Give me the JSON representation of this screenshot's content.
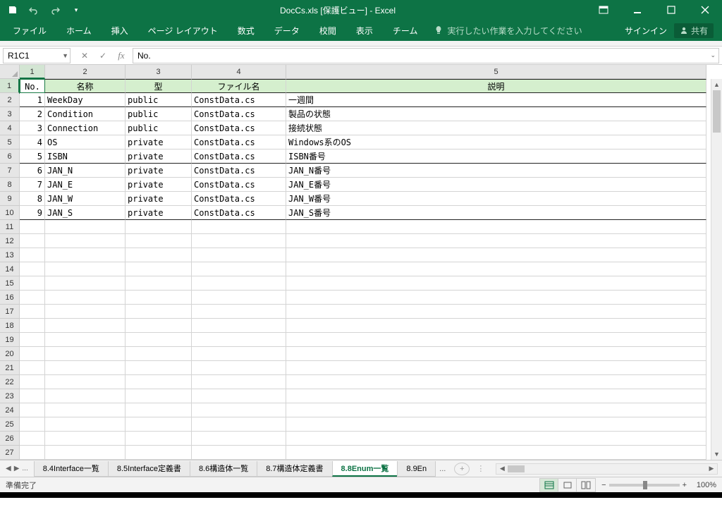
{
  "app": {
    "title": "DocCs.xls  [保護ビュー] - Excel",
    "qat": {
      "save": "save",
      "undo": "undo",
      "redo": "redo"
    }
  },
  "window": {
    "restore": "restore",
    "minimize": "minimize",
    "maximize": "maximize",
    "close": "close"
  },
  "ribbon": {
    "tabs": [
      "ファイル",
      "ホーム",
      "挿入",
      "ページ レイアウト",
      "数式",
      "データ",
      "校閲",
      "表示",
      "チーム"
    ],
    "tellme": "実行したい作業を入力してください",
    "signin": "サインイン",
    "share": "共有"
  },
  "formula": {
    "name_box": "R1C1",
    "value": "No."
  },
  "columns": [
    "1",
    "2",
    "3",
    "4",
    "5"
  ],
  "headers": [
    "No.",
    "名称",
    "型",
    "ファイル名",
    "説明"
  ],
  "rows": [
    {
      "no": "1",
      "name": "WeekDay",
      "type": "public",
      "file": "ConstData.cs",
      "desc": "一週間"
    },
    {
      "no": "2",
      "name": "Condition",
      "type": "public",
      "file": "ConstData.cs",
      "desc": "製品の状態"
    },
    {
      "no": "3",
      "name": "Connection",
      "type": "public",
      "file": "ConstData.cs",
      "desc": "接続状態"
    },
    {
      "no": "4",
      "name": "OS",
      "type": "private",
      "file": "ConstData.cs",
      "desc": "Windows系のOS"
    },
    {
      "no": "5",
      "name": "ISBN",
      "type": "private",
      "file": "ConstData.cs",
      "desc": "ISBN番号"
    },
    {
      "no": "6",
      "name": "JAN_N",
      "type": "private",
      "file": "ConstData.cs",
      "desc": "JAN_N番号"
    },
    {
      "no": "7",
      "name": "JAN_E",
      "type": "private",
      "file": "ConstData.cs",
      "desc": "JAN_E番号"
    },
    {
      "no": "8",
      "name": "JAN_W",
      "type": "private",
      "file": "ConstData.cs",
      "desc": "JAN_W番号"
    },
    {
      "no": "9",
      "name": "JAN_S",
      "type": "private",
      "file": "ConstData.cs",
      "desc": "JAN_S番号"
    }
  ],
  "empty_rows": 17,
  "sheet_tabs": {
    "hidden_left": "...",
    "tabs": [
      "8.4Interface一覧",
      "8.5Interface定義書",
      "8.6構造体一覧",
      "8.7構造体定義書",
      "8.8Enum一覧",
      "8.9En"
    ],
    "active": "8.8Enum一覧",
    "more": "..."
  },
  "status": {
    "ready": "準備完了",
    "zoom": "100%"
  },
  "colors": {
    "brand": "#0d7345",
    "header_fill": "#d5efce"
  }
}
